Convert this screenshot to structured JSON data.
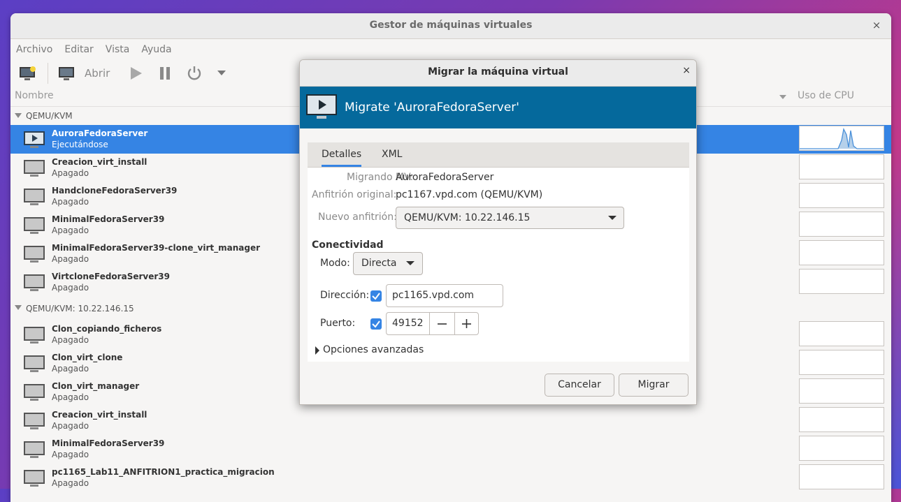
{
  "window": {
    "title": "Gestor de máquinas virtuales",
    "close": "×"
  },
  "menu": [
    "Archivo",
    "Editar",
    "Vista",
    "Ayuda"
  ],
  "toolbar": {
    "open_label": "Abrir"
  },
  "columns": {
    "name": "Nombre",
    "cpu": "Uso de CPU"
  },
  "groups": [
    {
      "label": "QEMU/KVM",
      "vms": [
        {
          "name": "AuroraFedoraServer",
          "status": "Ejecutándose",
          "selected": true
        },
        {
          "name": "Creacion_virt_install",
          "status": "Apagado"
        },
        {
          "name": "HandcloneFedoraServer39",
          "status": "Apagado"
        },
        {
          "name": "MinimalFedoraServer39",
          "status": "Apagado"
        },
        {
          "name": "MinimalFedoraServer39-clone_virt_manager",
          "status": "Apagado"
        },
        {
          "name": "VirtcloneFedoraServer39",
          "status": "Apagado"
        }
      ]
    },
    {
      "label": "QEMU/KVM: 10.22.146.15",
      "vms": [
        {
          "name": "Clon_copiando_ficheros",
          "status": "Apagado"
        },
        {
          "name": "Clon_virt_clone",
          "status": "Apagado"
        },
        {
          "name": "Clon_virt_manager",
          "status": "Apagado"
        },
        {
          "name": "Creacion_virt_install",
          "status": "Apagado"
        },
        {
          "name": "MinimalFedoraServer39",
          "status": "Apagado"
        },
        {
          "name": "pc1165_Lab11_ANFITRION1_practica_migracion",
          "status": "Apagado"
        }
      ]
    }
  ],
  "dialog": {
    "title": "Migrar la máquina virtual",
    "close": "×",
    "banner": "Migrate 'AuroraFedoraServer'",
    "tabs": [
      "Detalles",
      "XML"
    ],
    "migrating_label": "Migrando MV:",
    "migrating_value": "AuroraFedoraServer",
    "orig_host_label": "Anfitrión original:",
    "orig_host_value": "pc1167.vpd.com (QEMU/KVM)",
    "new_host_label": "Nuevo anfitrión:",
    "new_host_value": "QEMU/KVM: 10.22.146.15",
    "connectivity": "Conectividad",
    "mode_label": "Modo:",
    "mode_value": "Directa",
    "address_label": "Dirección:",
    "address_value": "pc1165.vpd.com",
    "port_label": "Puerto:",
    "port_value": "49152",
    "advanced": "Opciones avanzadas",
    "cancel": "Cancelar",
    "migrate": "Migrar"
  }
}
